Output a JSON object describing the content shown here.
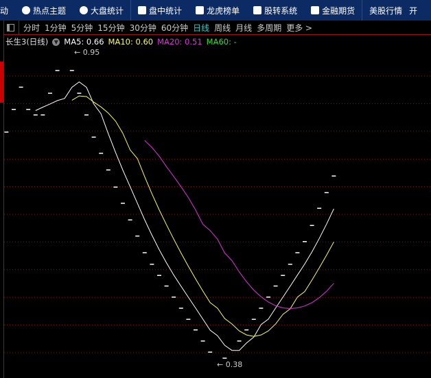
{
  "nav": {
    "items": [
      {
        "label": "热点主题",
        "icon": "flame-icon"
      },
      {
        "label": "大盘统计",
        "icon": "pie-chart-icon"
      },
      {
        "label": "盘中统计",
        "icon": "line-chart-icon"
      },
      {
        "label": "龙虎榜单",
        "icon": "ranking-icon"
      },
      {
        "label": "股转系统",
        "icon": "list-icon"
      },
      {
        "label": "金融期货",
        "icon": "futures-icon"
      },
      {
        "label": "美股行情",
        "icon": ""
      }
    ],
    "partial_left": "动",
    "partial_right": "开"
  },
  "toolbar": {
    "periods": [
      "分时",
      "1分钟",
      "5分钟",
      "15分钟",
      "30分钟",
      "60分钟",
      "日线",
      "周线",
      "月线",
      "多周期",
      "更多 >"
    ],
    "active": "日线"
  },
  "legend": {
    "title": "长生3(日线)",
    "ma5": "MA5: 0.66",
    "ma10": "MA10: 0.60",
    "ma20": "MA20: 0.51",
    "ma60": "MA60: -"
  },
  "colors": {
    "ma5": "#ffffff",
    "ma10": "#ffff40",
    "ma20": "#e030e0",
    "ma60": "#30e030",
    "grid": "#7a1010",
    "nav_bg": "#0c2a64"
  },
  "chart_data": {
    "type": "candlestick",
    "grid": true,
    "high_label": "0.95",
    "low_label": "0.38",
    "closes": [
      0.828,
      0.873,
      0.917,
      0.873,
      0.862,
      0.862,
      0.905,
      0.95,
      null,
      0.95,
      0.905,
      0.862,
      0.818,
      0.786,
      0.753,
      0.719,
      0.687,
      0.654,
      0.622,
      0.589,
      0.566,
      0.544,
      0.523,
      0.501,
      0.479,
      0.457,
      0.436,
      0.414,
      0.392,
      null,
      0.38,
      null,
      0.414,
      0.436,
      0.457,
      0.479,
      0.501,
      0.523,
      0.544,
      0.566,
      0.589,
      0.611,
      0.643,
      0.677,
      0.708,
      0.741
    ],
    "moving_averages": [
      5,
      10,
      20
    ]
  }
}
